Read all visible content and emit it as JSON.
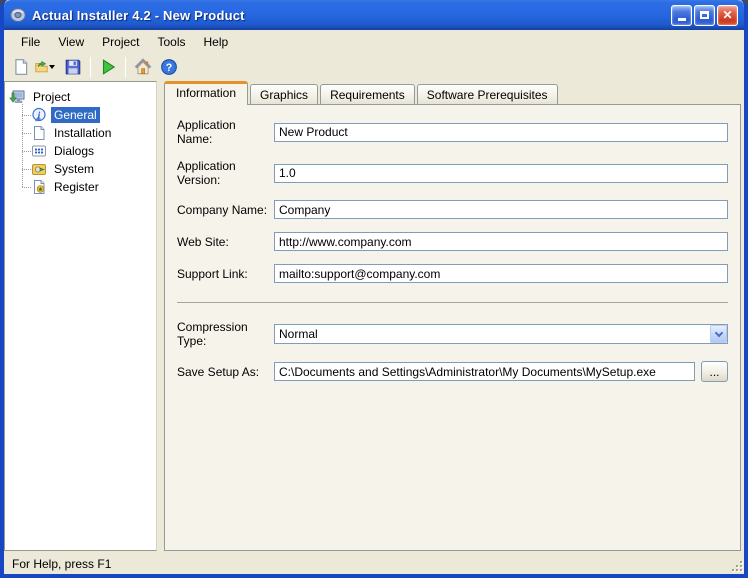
{
  "window": {
    "title": "Actual Installer 4.2 - New Product",
    "controls": {
      "minimize_icon": "minimize-icon",
      "maximize_icon": "maximize-icon",
      "close_icon": "close-icon",
      "close_glyph": "✕"
    }
  },
  "menu": {
    "items": [
      "File",
      "View",
      "Project",
      "Tools",
      "Help"
    ]
  },
  "toolbar": {
    "buttons": [
      {
        "icon": "new-document-icon"
      },
      {
        "icon": "open-folder-icon"
      },
      {
        "icon": "save-icon"
      },
      {
        "icon": "run-build-icon"
      },
      {
        "icon": "home-icon"
      },
      {
        "icon": "help-icon"
      }
    ]
  },
  "sidebar": {
    "root": {
      "label": "Project",
      "icon": "project-icon"
    },
    "items": [
      {
        "label": "General",
        "icon": "info-icon",
        "selected": true
      },
      {
        "label": "Installation",
        "icon": "document-icon",
        "selected": false
      },
      {
        "label": "Dialogs",
        "icon": "dialogs-icon",
        "selected": false
      },
      {
        "label": "System",
        "icon": "system-icon",
        "selected": false
      },
      {
        "label": "Register",
        "icon": "register-icon",
        "selected": false
      }
    ]
  },
  "tabs": {
    "items": [
      {
        "label": "Information",
        "active": true
      },
      {
        "label": "Graphics",
        "active": false
      },
      {
        "label": "Requirements",
        "active": false
      },
      {
        "label": "Software Prerequisites",
        "active": false
      }
    ]
  },
  "form": {
    "fields": [
      {
        "label": "Application Name:",
        "value": "New Product"
      },
      {
        "label": "Application Version:",
        "value": "1.0"
      },
      {
        "label": "Company Name:",
        "value": "Company"
      },
      {
        "label": "Web Site:",
        "value": "http://www.company.com"
      },
      {
        "label": "Support Link:",
        "value": "mailto:support@company.com"
      }
    ],
    "compression": {
      "label": "Compression Type:",
      "value": "Normal"
    },
    "save_setup": {
      "label": "Save Setup As:",
      "value": "C:\\Documents and Settings\\Administrator\\My Documents\\MySetup.exe",
      "browse_label": "..."
    }
  },
  "statusbar": {
    "text": "For Help, press F1"
  },
  "colors": {
    "titlebar_blue": "#2463DA",
    "window_border": "#1747C2",
    "chrome": "#ECE9D8",
    "tab_page": "#F6F4EA",
    "active_tab_accent": "#E5912D",
    "selection_blue": "#316AC5",
    "input_border": "#7F9DB9"
  }
}
